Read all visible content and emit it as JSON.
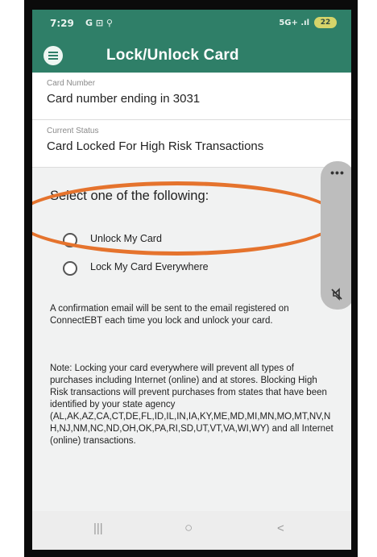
{
  "status_bar": {
    "time": "7:29",
    "notifications": "G ⊡ ⚲",
    "signal": "5G+ .ıl",
    "battery": "22"
  },
  "app_bar": {
    "title": "Lock/Unlock Card",
    "menu_icon": "hamburger-menu-icon"
  },
  "card_number": {
    "label": "Card Number",
    "value": "Card number ending in 3031"
  },
  "current_status": {
    "label": "Current Status",
    "value": "Card Locked For High Risk Transactions"
  },
  "options": {
    "title": "Select one of the following:",
    "items": [
      {
        "label": "Unlock My Card",
        "selected": false
      },
      {
        "label": "Lock My Card Everywhere",
        "selected": false
      }
    ]
  },
  "floating_panel": {
    "more": "•••",
    "mute_icon": "mute-icon"
  },
  "confirmation_text": "A confirmation email will be sent to the email registered on ConnectEBT each time you lock and unlock your card.",
  "note_text": "Note: Locking your card everywhere will prevent all types of purchases including Internet (online) and at stores. Blocking High Risk transactions will prevent purchases from states that have been identified by your state agency (AL,AK,AZ,CA,CT,DE,FL,ID,IL,IN,IA,KY,ME,MD,MI,MN,MO,MT,NV,NH,NJ,NM,NC,ND,OH,OK,PA,RI,SD,UT,VT,VA,WI,WY) and all Internet (online) transactions.",
  "nav_bar": {
    "recents": "|||",
    "home": "○",
    "back": "<"
  },
  "colors": {
    "app_bar": "#2f7f68",
    "highlight_oval": "#e5732d",
    "background": "#f1f2f2"
  }
}
